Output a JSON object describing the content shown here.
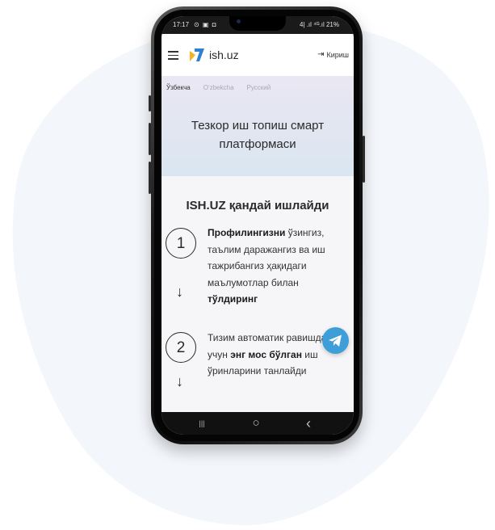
{
  "status_bar": {
    "time": "17:17",
    "left_icons": "⊙ ▣ ◘",
    "right": "4| .ıl ⁴ᴳ.ıl 21%"
  },
  "header": {
    "logo_text": "ish.uz",
    "login_label": "Кириш"
  },
  "languages": [
    {
      "label": "Ўзбекча",
      "active": true
    },
    {
      "label": "O‘zbekcha",
      "active": false
    },
    {
      "label": "Русский",
      "active": false
    }
  ],
  "hero": {
    "title": "Тезкор иш топиш смарт платформаси"
  },
  "how_it_works": {
    "title": "ISH.UZ қандай ишлайди",
    "steps": [
      {
        "number": "1",
        "bold_start": "Профилингизни",
        "text_mid": " ўзингиз, таълим даражангиз ва иш тажрибангиз ҳақидаги маълумотлар билан ",
        "bold_end": "тўлдиринг",
        "arrow": "↓"
      },
      {
        "number": "2",
        "text_start": "Тизим автоматик равишда сиз учун ",
        "bold_mid": "энг мос бўлган",
        "text_end": " иш ўринларини танлайди",
        "arrow": "↓"
      }
    ]
  },
  "nav_bar": {
    "recent": "|||",
    "home": "○",
    "back": "‹"
  },
  "colors": {
    "telegram": "#3d9ed8",
    "logo_blue": "#2f7fd3",
    "logo_yellow": "#f2b51f",
    "blob": "#f3f6fb"
  },
  "icons": [
    "hamburger-icon",
    "login-icon",
    "telegram-icon",
    "recent-apps-icon",
    "home-icon",
    "back-icon"
  ]
}
